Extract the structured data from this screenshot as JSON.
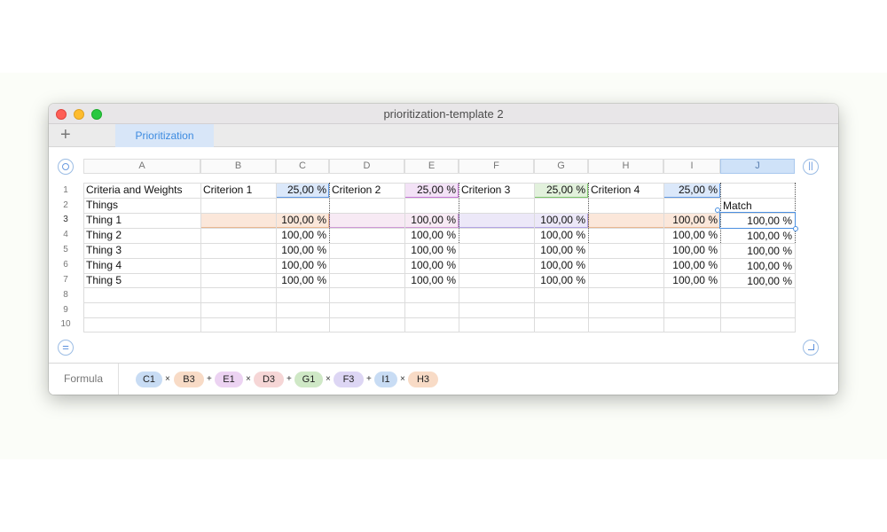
{
  "window": {
    "title": "prioritization-template 2"
  },
  "tabs": {
    "add_label": "+",
    "active": "Prioritization"
  },
  "columns": [
    "A",
    "B",
    "C",
    "D",
    "E",
    "F",
    "G",
    "H",
    "I",
    "J"
  ],
  "rows": [
    "1",
    "2",
    "3",
    "4",
    "5",
    "6",
    "7",
    "8",
    "9",
    "10"
  ],
  "cells": {
    "a1": "Criteria and Weights",
    "b1": "Criterion 1",
    "c1": "25,00 %",
    "d1": "Criterion 2",
    "e1": "25,00 %",
    "f1": "Criterion 3",
    "g1": "25,00 %",
    "h1": "Criterion 4",
    "i1": "25,00 %",
    "a2": "Things",
    "j2": "Match",
    "a3": "Thing 1",
    "a4": "Thing 2",
    "a5": "Thing 3",
    "a6": "Thing 4",
    "a7": "Thing 5",
    "pct": "100,00 %"
  },
  "formula": {
    "label": "Formula",
    "tokens": [
      "C1",
      "B3",
      "E1",
      "D3",
      "G1",
      "F3",
      "I1",
      "H3"
    ],
    "ops": [
      "×",
      "+",
      "×",
      "+",
      "×",
      "+",
      "×"
    ]
  },
  "colors": {
    "criterion1": "#b9cff0",
    "criterion2": "#e2c4ec",
    "criterion3": "#c6e4bd",
    "criterion4": "#f6d6bd",
    "selection": "#4a8fe0"
  }
}
